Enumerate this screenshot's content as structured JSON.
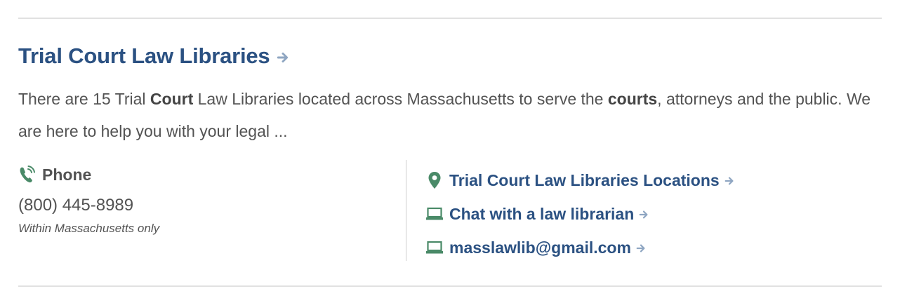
{
  "result": {
    "title": "Trial Court Law Libraries",
    "summary": {
      "t1": "There are 15 Trial ",
      "b1": "Court",
      "t2": " Law Libraries located across Massachusetts to serve the ",
      "b2": "courts",
      "t3": ", attorneys and the public. We are here to help you with your legal ..."
    },
    "phone": {
      "label": "Phone",
      "number": "(800) 445-8989",
      "note": "Within Massachusetts only"
    },
    "links": [
      {
        "label": "Trial Court Law Libraries Locations",
        "icon": "map-pin-icon"
      },
      {
        "label": "Chat with a law librarian",
        "icon": "laptop-icon"
      },
      {
        "label": "masslawlib@gmail.com",
        "icon": "laptop-icon"
      }
    ]
  },
  "colors": {
    "link": "#2b5182",
    "text": "#535353",
    "icon_green": "#4a8a68",
    "arrow": "#8fa6c2"
  }
}
